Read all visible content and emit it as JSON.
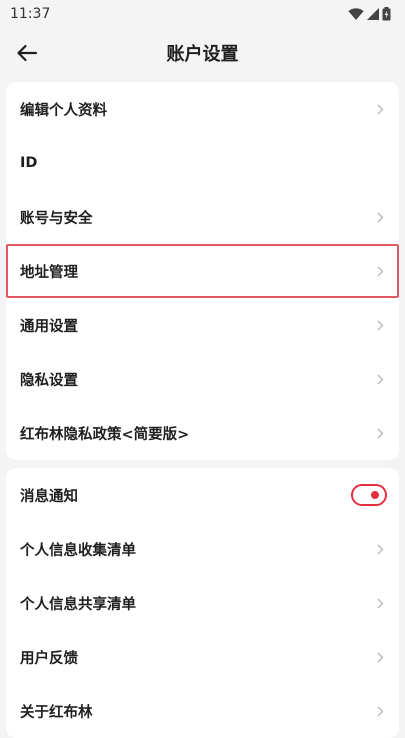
{
  "status_bar": {
    "time": "11:37"
  },
  "header": {
    "title": "账户设置"
  },
  "colors": {
    "accent": "#e33040",
    "highlight_border": "#e05a63"
  },
  "group1": {
    "items": [
      {
        "label": "编辑个人资料"
      },
      {
        "label": "ID"
      },
      {
        "label": "账号与安全"
      },
      {
        "label": "地址管理"
      },
      {
        "label": "通用设置"
      },
      {
        "label": "隐私设置"
      },
      {
        "label": "红布林隐私政策<简要版>"
      }
    ]
  },
  "group2": {
    "items": [
      {
        "label": "消息通知",
        "toggle_on": true
      },
      {
        "label": "个人信息收集清单"
      },
      {
        "label": "个人信息共享清单"
      },
      {
        "label": "用户反馈"
      },
      {
        "label": "关于红布林"
      }
    ]
  }
}
